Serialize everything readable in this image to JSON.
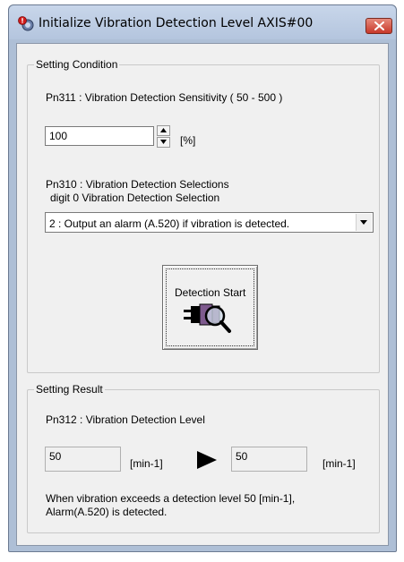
{
  "window": {
    "title": "Initialize Vibration Detection Level AXIS#00"
  },
  "icons": {
    "app": "app-icon",
    "close": "close-icon",
    "spin_up": "triangle-up-icon",
    "spin_down": "triangle-down-icon",
    "dropdown": "chevron-down-icon",
    "detection": "detection-magnifier-icon",
    "arrow": "arrow-right-icon"
  },
  "colors": {
    "close_button": "#c8382a",
    "window_frame": "#aebfd6",
    "client_bg": "#f0f0f0"
  },
  "setting_condition": {
    "legend": "Setting Condition",
    "sensitivity_label": "Pn311 : Vibration Detection Sensitivity  ( 50 - 500 )",
    "sensitivity_value": "100",
    "sensitivity_unit": "[%]",
    "selection_label_line1": "Pn310 : Vibration Detection Selections",
    "selection_label_line2": "digit 0 Vibration Detection Selection",
    "selection_value": "2 : Output an alarm (A.520) if vibration is detected.",
    "detection_button": "Detection Start"
  },
  "setting_result": {
    "legend": "Setting Result",
    "level_label": "Pn312 : Vibration Detection Level",
    "before_value": "50",
    "before_unit": "[min-1]",
    "after_value": "50",
    "after_unit": "[min-1]",
    "message_line1": "When vibration exceeds a detection level 50 [min-1],",
    "message_line2": "Alarm(A.520) is detected."
  }
}
